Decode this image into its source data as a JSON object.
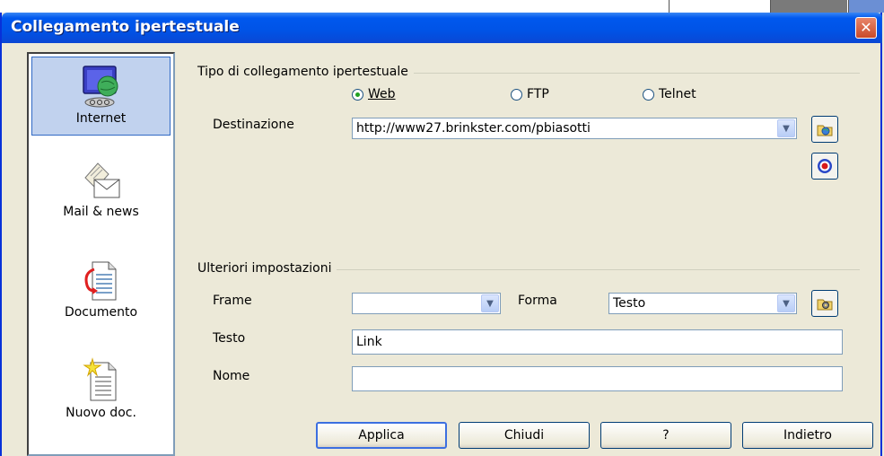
{
  "window": {
    "title": "Collegamento ipertestuale",
    "close_glyph": "✕"
  },
  "sidebar": {
    "items": [
      {
        "label": "Internet",
        "icon": "globe-monitor-icon",
        "selected": true
      },
      {
        "label": "Mail & news",
        "icon": "mail-letter-icon",
        "selected": false
      },
      {
        "label": "Documento",
        "icon": "document-arrow-icon",
        "selected": false
      },
      {
        "label": "Nuovo doc.",
        "icon": "new-document-icon",
        "selected": false
      }
    ]
  },
  "link_type": {
    "group_label": "Tipo di collegamento ipertestuale",
    "options": [
      {
        "label": "Web",
        "selected": true
      },
      {
        "label": "FTP",
        "selected": false
      },
      {
        "label": "Telnet",
        "selected": false
      }
    ]
  },
  "destination": {
    "label": "Destinazione",
    "value": "http://www27.brinkster.com/pbiasotti"
  },
  "further_settings": {
    "group_label": "Ulteriori impostazioni",
    "frame_label": "Frame",
    "frame_value": "",
    "form_label": "Forma",
    "form_value": "Testo",
    "text_label": "Testo",
    "text_value": "Link",
    "name_label": "Nome",
    "name_value": ""
  },
  "buttons": {
    "apply": "Applica",
    "close": "Chiudi",
    "help": "?",
    "back": "Indietro"
  },
  "colors": {
    "titlebar": "#0053e6",
    "dialog_bg": "#ece9d8",
    "radio_dot": "#21a121"
  }
}
